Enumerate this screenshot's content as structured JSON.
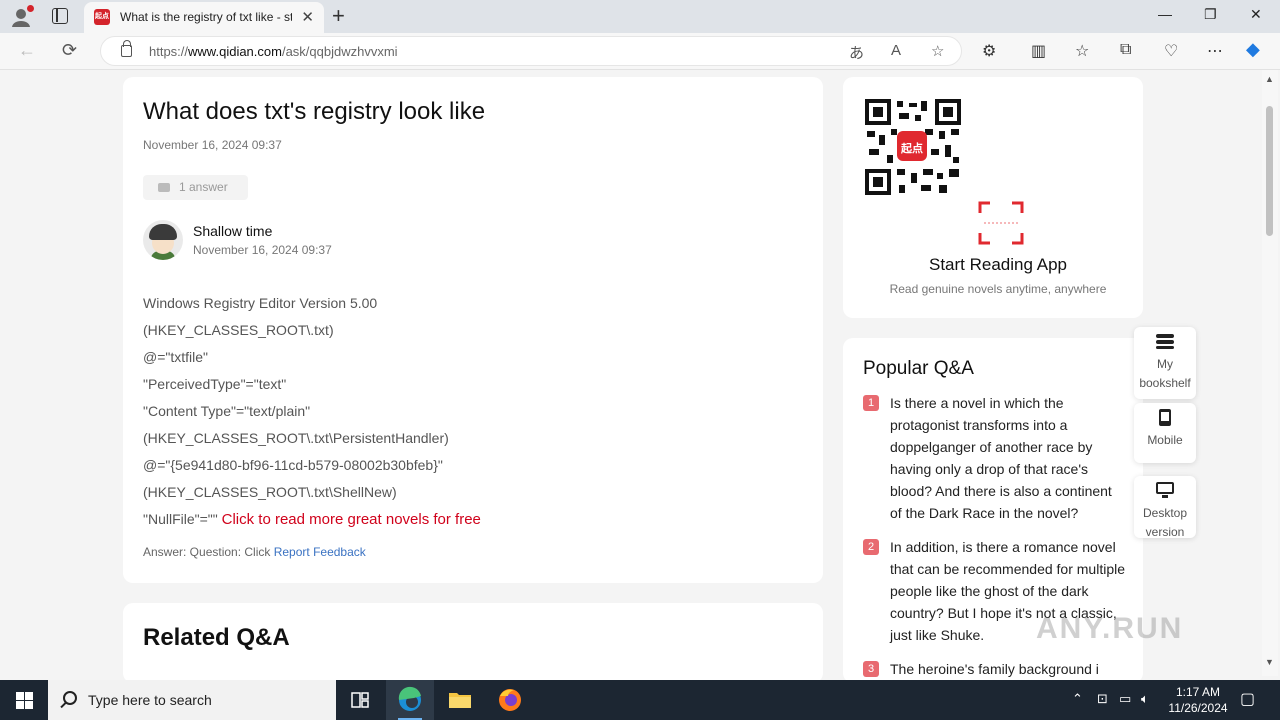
{
  "browser": {
    "tab_title": "What is the registry of txt like - st",
    "favicon_text": "起点",
    "url_prefix": "https://",
    "url_host": "www.qidian.com",
    "url_path": "/ask/qqbjdwzhvvxmi"
  },
  "question": {
    "title": "What does txt's registry look like",
    "date": "November 16, 2024 09:37",
    "answer_count": "1 answer"
  },
  "answer": {
    "author": "Shallow time",
    "date": "November 16, 2024 09:37",
    "lines": [
      "Windows Registry Editor Version 5.00",
      "(HKEY_CLASSES_ROOT\\.txt)",
      "@=\"txtfile\"",
      "\"PerceivedType\"=\"text\"",
      "\"Content Type\"=\"text/plain\"",
      "(HKEY_CLASSES_ROOT\\.txt\\PersistentHandler)",
      "@=\"{5e941d80-bf96-11cd-b579-08002b30bfeb}\"",
      "(HKEY_CLASSES_ROOT\\.txt\\ShellNew)"
    ],
    "last_line": "\"NullFile\"=\"\" ",
    "read_more": "Click to read more great novels for free",
    "footer_prefix": "Answer: Question: Click ",
    "report_link": "Report Feedback"
  },
  "related": {
    "heading": "Related Q&A"
  },
  "app_promo": {
    "qr_badge": "起点",
    "title": "Start Reading App",
    "subtitle": "Read genuine novels anytime, anywhere"
  },
  "popular": {
    "heading": "Popular Q&A",
    "items": [
      {
        "num": "1",
        "text": "Is there a novel in which the protagonist transforms into a doppelganger of another race by having only a drop of that race's blood? And there is also a continent of the Dark Race in the novel?"
      },
      {
        "num": "2",
        "text": "In addition, is there a romance novel that can be recommended for multiple people like the ghost of the dark country? But I hope it's not a classic, just like Shuke."
      },
      {
        "num": "3",
        "text": "The heroine's family background i"
      }
    ]
  },
  "float_buttons": {
    "bookshelf": "My bookshelf",
    "mobile": "Mobile",
    "desktop": "Desktop version"
  },
  "watermark": "ANY.RUN",
  "taskbar": {
    "search_placeholder": "Type here to search",
    "time": "1:17 AM",
    "date": "11/26/2024"
  },
  "colors": {
    "brand_red": "#d0021b",
    "link_blue": "#3a72c2",
    "rank_badge": "#e86a70"
  }
}
